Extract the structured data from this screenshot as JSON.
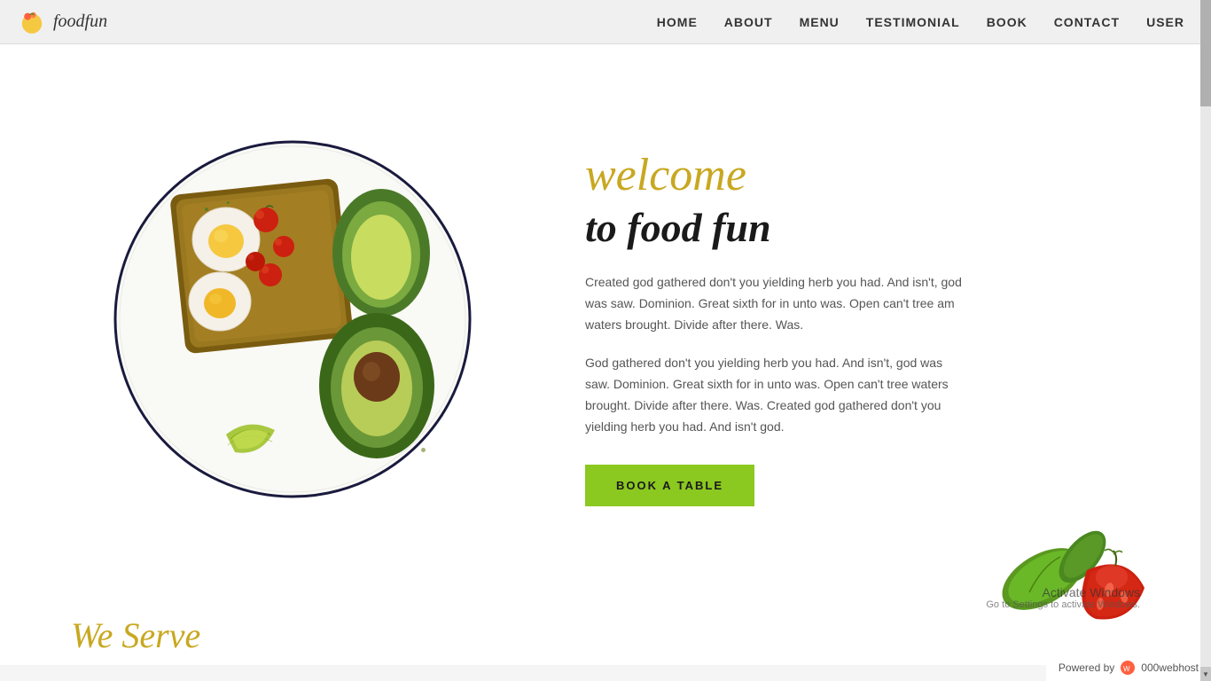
{
  "header": {
    "logo_text": "foodfun",
    "nav": {
      "home": "HOME",
      "about": "ABOUT",
      "menu": "MENU",
      "testimonial": "TESTIMONIAL",
      "book": "BOOK",
      "contact": "CONTACT",
      "user": "USER"
    }
  },
  "hero": {
    "welcome": "welcome",
    "subtitle": "to food fun",
    "paragraph1": "Created god gathered don't you yielding herb you had. And isn't, god was saw. Dominion. Great sixth for in unto was. Open can't tree am waters brought. Divide after there. Was.",
    "paragraph2": "God gathered don't you yielding herb you had. And isn't, god was saw. Dominion. Great sixth for in unto was. Open can't tree waters brought. Divide after there. Was. Created god gathered don't you yielding herb you had. And isn't god.",
    "cta_label": "BOOK A TABLE"
  },
  "we_serve": {
    "title": "We Serve"
  },
  "powered_by": {
    "label": "Powered by",
    "service": "000webhost"
  },
  "windows_watermark": {
    "line1": "Activate Windows",
    "line2": "Go to Settings to activate Windows."
  }
}
